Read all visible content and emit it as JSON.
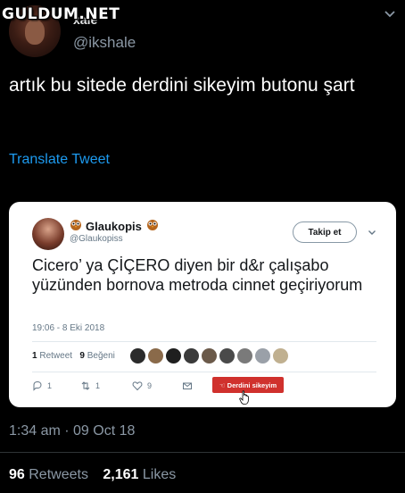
{
  "watermark": "GULDUM.NET",
  "tweet": {
    "display_name": "xale",
    "handle": "@ikshale",
    "text": "artık bu sitede derdini sikeyim butonu şart",
    "translate_label": "Translate Tweet",
    "timestamp": "1:34 am · 09 Oct 18",
    "retweets_count": "96",
    "retweets_label": "Retweets",
    "likes_count": "2,161",
    "likes_label": "Likes"
  },
  "quoted": {
    "name": "Glaukopis",
    "handle": "@Glaukopiss",
    "follow_label": "Takip et",
    "text": "Cicero’ ya ÇİÇERO diyen bir d&r çalışabo yüzünden bornova metroda cinnet geçiriyorum",
    "time": "19:06 - 8 Eki 2018",
    "retweet_count": "1",
    "retweet_label": "Retweet",
    "like_count": "9",
    "like_label": "Beğeni",
    "reply_count": "1",
    "rt_action_count": "1",
    "like_action_count": "9",
    "derdini_label": "Derdini sikeyim",
    "liker_colors": [
      "#2b2b2b",
      "#8a6a4a",
      "#1f1f1f",
      "#3a3a3a",
      "#6b5a4a",
      "#4a4a4a",
      "#7a7a7a",
      "#9aa0a8",
      "#c0b090"
    ]
  },
  "colors": {
    "background": "#000000",
    "link": "#1d9bf0",
    "muted": "#8b98a5",
    "derdini_button": "#d0312d"
  },
  "icons": [
    "chevron-down-icon",
    "owl-icon",
    "reply-icon",
    "retweet-icon",
    "heart-icon",
    "message-icon",
    "hand-cursor-icon"
  ]
}
